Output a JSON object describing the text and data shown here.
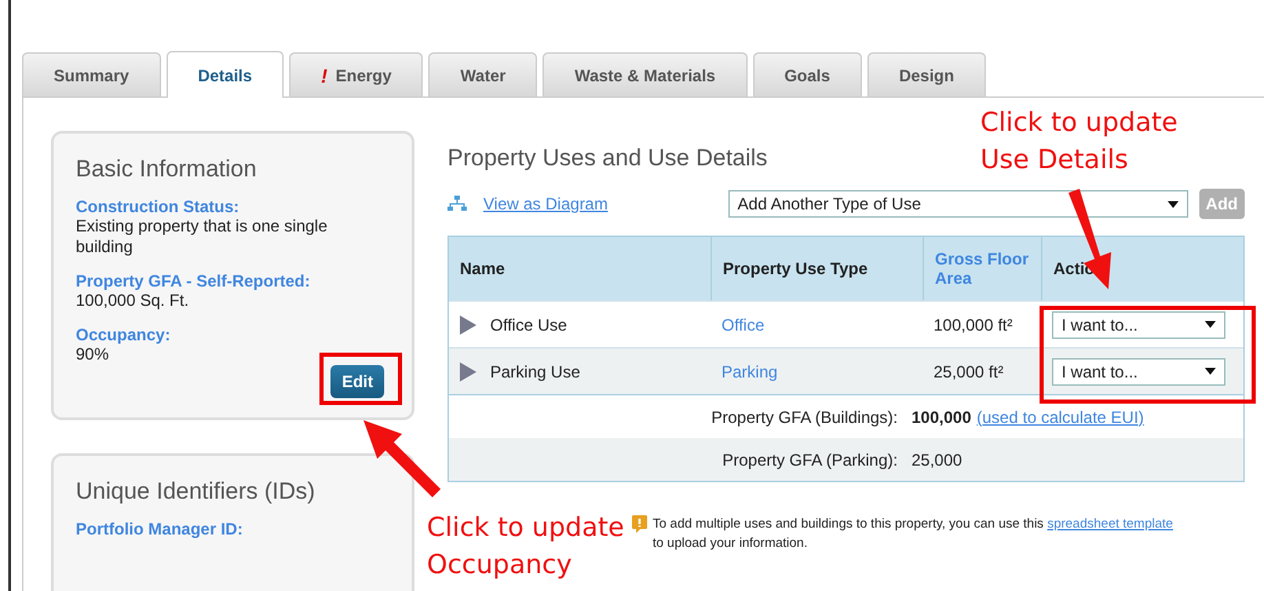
{
  "tabs": [
    {
      "label": "Summary",
      "selected": false
    },
    {
      "label": "Details",
      "selected": true
    },
    {
      "label": "Energy",
      "selected": false,
      "badge": "!"
    },
    {
      "label": "Water",
      "selected": false
    },
    {
      "label": "Waste & Materials",
      "selected": false
    },
    {
      "label": "Goals",
      "selected": false
    },
    {
      "label": "Design",
      "selected": false
    }
  ],
  "basic_information": {
    "title": "Basic Information",
    "fields": [
      {
        "label": "Construction Status:",
        "value": "Existing property that is one single building"
      },
      {
        "label": "Property GFA - Self-Reported:",
        "value": "100,000 Sq. Ft."
      },
      {
        "label": "Occupancy:",
        "value": "90%"
      }
    ],
    "edit_button": "Edit"
  },
  "unique_identifiers": {
    "title": "Unique Identifiers (IDs)",
    "fields": [
      {
        "label": "Portfolio Manager ID:"
      }
    ]
  },
  "property_uses": {
    "title": "Property Uses and Use Details",
    "diagram_link": "View as Diagram",
    "use_select": "Add Another Type of Use",
    "add_button": {
      "label": "Add",
      "disabled": true
    },
    "columns": [
      "Name",
      "Property Use Type",
      "Gross Floor Area",
      "Actio"
    ],
    "rows": [
      {
        "name": "Office Use",
        "type": "Office",
        "area": "100,000 ft²",
        "action": "I want to...",
        "expanded": false
      },
      {
        "name": "Parking Use",
        "type": "Parking",
        "area": "25,000 ft²",
        "action": "I want to...",
        "expanded": false
      }
    ],
    "totals": [
      {
        "label": "Property GFA (Buildings):",
        "value": "100,000",
        "link": "(used to calculate EUI)"
      },
      {
        "label": "Property GFA (Parking):",
        "value": "25,000"
      }
    ],
    "note": {
      "text": "To add multiple uses and buildings to this property, you can use this",
      "link": "spreadsheet template",
      "after": "to upload your information."
    }
  },
  "annotations": [
    {
      "lines": [
        "Click to update",
        "Use Details"
      ]
    },
    {
      "lines": [
        "Click to update",
        "Occupancy"
      ]
    }
  ]
}
